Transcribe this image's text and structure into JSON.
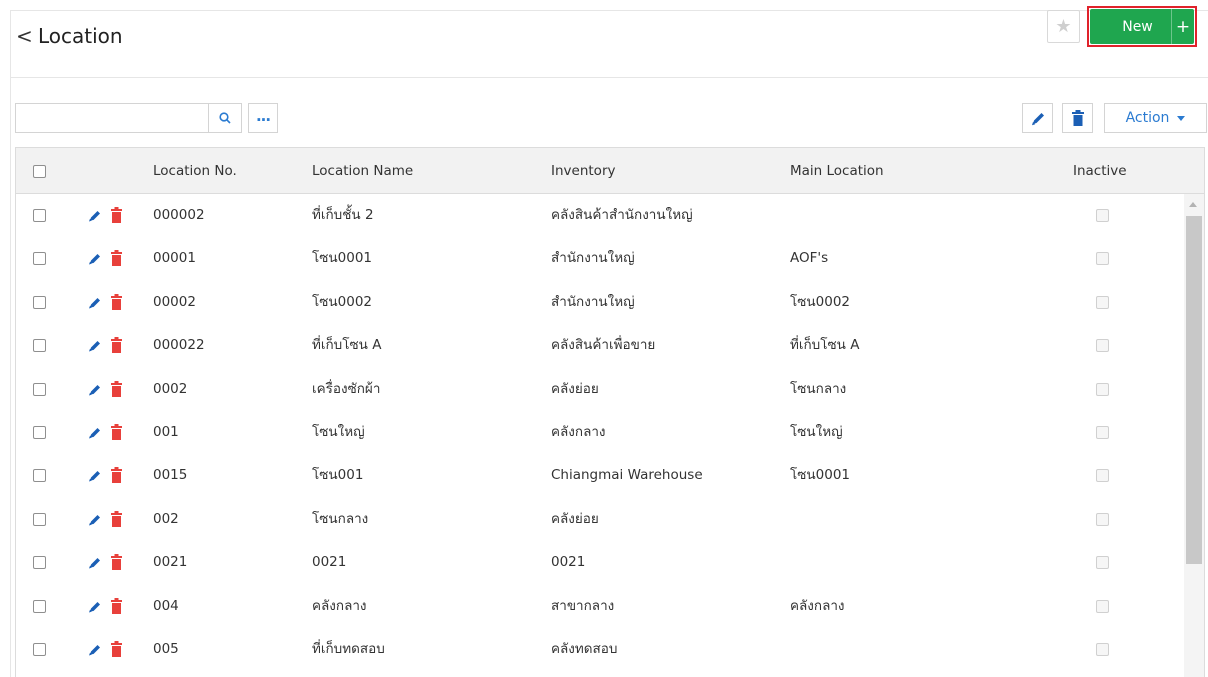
{
  "header": {
    "back_icon": "chevron-left-icon",
    "back_glyph": "<",
    "title": "Location",
    "favorite_icon": "star-icon",
    "new_label": "New",
    "new_plus": "+"
  },
  "toolbar": {
    "search_placeholder": "",
    "search_icon": "search-icon",
    "more_label": "...",
    "edit_icon": "pencil-icon",
    "delete_icon": "trash-icon",
    "action_label": "Action"
  },
  "table": {
    "columns": {
      "location_no": "Location No.",
      "location_name": "Location Name",
      "inventory": "Inventory",
      "main_location": "Main Location",
      "inactive": "Inactive"
    },
    "rows": [
      {
        "location_no": "000002",
        "location_name": "ที่เก็บชั้น 2",
        "inventory": "คลังสินค้าสำนักงานใหญ่",
        "main_location": ""
      },
      {
        "location_no": "00001",
        "location_name": "โซน0001",
        "inventory": "สำนักงานใหญ่",
        "main_location": "AOF's"
      },
      {
        "location_no": "00002",
        "location_name": "โซน0002",
        "inventory": "สำนักงานใหญ่",
        "main_location": "โซน0002"
      },
      {
        "location_no": "000022",
        "location_name": "ที่เก็บโซน A",
        "inventory": "คลังสินค้าเพื่อขาย",
        "main_location": "ที่เก็บโซน A"
      },
      {
        "location_no": "0002",
        "location_name": "เครื่องซักผ้า",
        "inventory": "คลังย่อย",
        "main_location": "โซนกลาง"
      },
      {
        "location_no": "001",
        "location_name": "โซนใหญ่",
        "inventory": "คลังกลาง",
        "main_location": "โซนใหญ่"
      },
      {
        "location_no": "0015",
        "location_name": "โซน001",
        "inventory": "Chiangmai Warehouse",
        "main_location": "โซน0001"
      },
      {
        "location_no": "002",
        "location_name": "โซนกลาง",
        "inventory": "คลังย่อย",
        "main_location": ""
      },
      {
        "location_no": "0021",
        "location_name": "0021",
        "inventory": "0021",
        "main_location": ""
      },
      {
        "location_no": "004",
        "location_name": "คลังกลาง",
        "inventory": "สาขากลาง",
        "main_location": "คลังกลาง"
      },
      {
        "location_no": "005",
        "location_name": "ที่เก็บทดสอบ",
        "inventory": "คลังทดสอบ",
        "main_location": ""
      }
    ]
  },
  "colors": {
    "new_button": "#1fa64f",
    "highlight_outline": "#e0222b",
    "edit_icon": "#1b5fb5",
    "delete_icon": "#e8403b",
    "link_blue": "#2b7bd1"
  }
}
